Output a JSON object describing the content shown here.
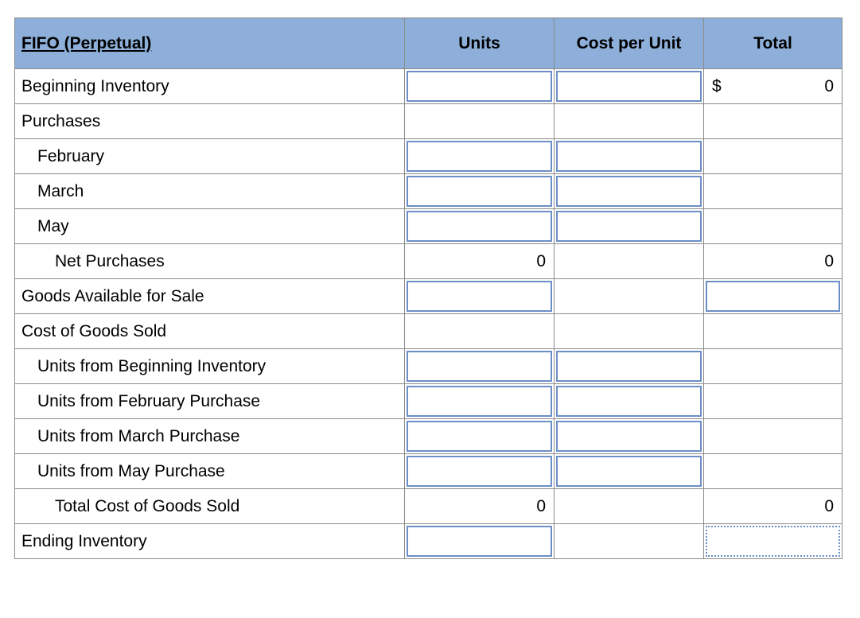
{
  "header": {
    "title": "FIFO (Perpetual)",
    "col_units": "Units",
    "col_cpu": "Cost per Unit",
    "col_total": "Total"
  },
  "currency_symbol": "$",
  "rows": {
    "beginning_inventory": {
      "label": "Beginning Inventory",
      "units": "",
      "cpu": "",
      "total": "0"
    },
    "purchases_header": {
      "label": "Purchases"
    },
    "feb": {
      "label": "February",
      "units": "",
      "cpu": ""
    },
    "mar": {
      "label": "March",
      "units": "",
      "cpu": ""
    },
    "may": {
      "label": "May",
      "units": "",
      "cpu": ""
    },
    "net_purchases": {
      "label": "Net Purchases",
      "units": "0",
      "total": "0"
    },
    "gafs": {
      "label": "Goods Available for Sale",
      "units": "",
      "total": ""
    },
    "cogs_header": {
      "label": "Cost of Goods Sold"
    },
    "units_bi": {
      "label": "Units from Beginning Inventory",
      "units": "",
      "cpu": ""
    },
    "units_feb": {
      "label": "Units from February Purchase",
      "units": "",
      "cpu": ""
    },
    "units_mar": {
      "label": "Units from March Purchase",
      "units": "",
      "cpu": ""
    },
    "units_may": {
      "label": "Units from May Purchase",
      "units": "",
      "cpu": ""
    },
    "total_cogs": {
      "label": "Total Cost of Goods Sold",
      "units": "0",
      "total": "0"
    },
    "ending_inventory": {
      "label": "Ending Inventory",
      "units": "",
      "total": ""
    }
  }
}
